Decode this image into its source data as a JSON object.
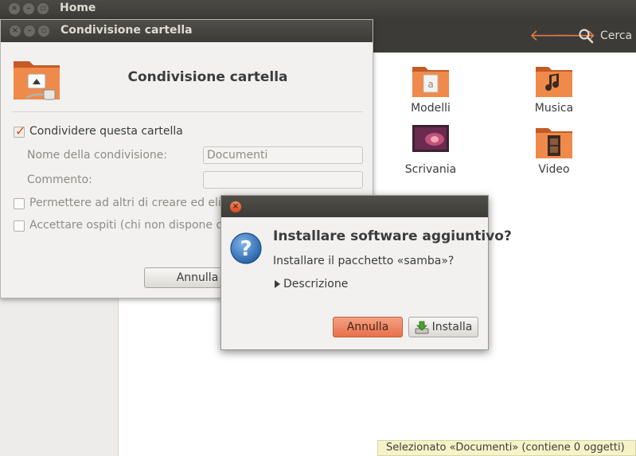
{
  "file_manager": {
    "window_title": "Home",
    "search_label": "Cerca",
    "items": [
      {
        "label": "Modelli"
      },
      {
        "label": "Musica"
      },
      {
        "label": "Scrivania"
      },
      {
        "label": "Video"
      }
    ],
    "status": "Selezionato «Documenti» (contiene 0 oggetti)"
  },
  "share_dialog": {
    "window_title": "Condivisione cartella",
    "heading": "Condivisione cartella",
    "share_checkbox_label": "Condividere questa cartella",
    "share_name_label": "Nome della condivisione:",
    "share_name_value": "Documenti",
    "comment_label": "Commento:",
    "comment_value": "",
    "allow_others_label": "Permettere ad altri di creare ed elim",
    "guest_access_label": "Accettare ospiti (chi non dispone di",
    "cancel_label": "Annulla"
  },
  "install_dialog": {
    "heading": "Installare software aggiuntivo?",
    "message": "Installare il pacchetto «samba»?",
    "expander_label": "Descrizione",
    "cancel_label": "Annulla",
    "install_label": "Installa"
  },
  "colors": {
    "accent": "#dd4814",
    "titlebar": "#3c3b37",
    "status_bg": "#f6f3c8"
  }
}
